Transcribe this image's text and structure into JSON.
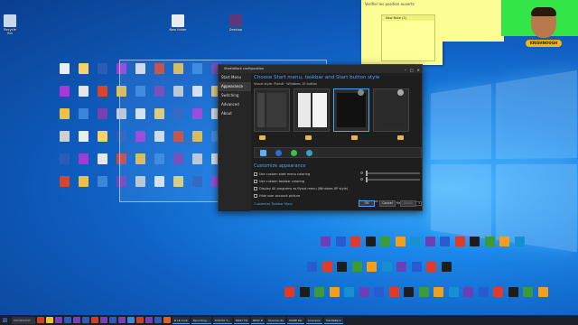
{
  "desktop": {
    "icon_labels_top": [
      "Recycle Bin",
      "New folder",
      "Desktop"
    ],
    "wallpaper": "Windows 10 blue light"
  },
  "sticky_note": {
    "text": "Verifier les position ouverts",
    "window_title": "New Note (1)"
  },
  "avatar": {
    "badge": "KRISHNOUGH"
  },
  "config_window": {
    "title": "StartIsBack configuration",
    "controls": {
      "minimize": "–",
      "maximize": "□",
      "close": "✕"
    },
    "nav": [
      "Start Menu",
      "Appearance",
      "Switching",
      "Advanced",
      "About"
    ],
    "active_nav": "Appearance",
    "heading": "Choose Start menu, taskbar and Start button style",
    "subheading": "Visual style:  Plain8  ·  Windows 10 button",
    "section_title": "Customize appearance",
    "options": [
      "Use custom start menu coloring",
      "Use custom taskbar coloring",
      "Display All programs as flyout menu (Windows XP style)",
      "Hide user account picture"
    ],
    "link": "Customize Taskbar More",
    "taskbar_icon_size_label": "Taskbar icon size:",
    "taskbar_icon_size": "1",
    "margins_label": "Margins:",
    "margins": "1",
    "buttons": {
      "ok": "OK",
      "cancel": "Cancel",
      "apply": "Apply"
    }
  },
  "taskbar": {
    "search_text": "rechercher",
    "tasks": [
      "R Lit Cont",
      "Recording...",
      "TOYOTA T...",
      "FIRST TO",
      "BEST B",
      "Chrome dis",
      "HOME Par",
      "Connexio",
      "StartIsBack"
    ]
  },
  "colors": {
    "accent": "#4aa3ff",
    "window_bg": "#1e1e1e",
    "sticky_yellow": "#fdfd96",
    "sticky_green": "#31e646",
    "taskbar_bg": "#1c1f26"
  }
}
